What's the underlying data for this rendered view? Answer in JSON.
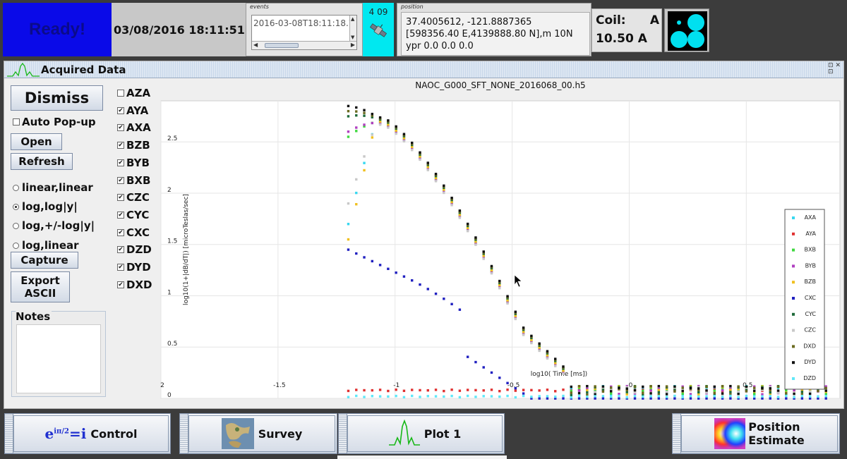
{
  "topbar": {
    "status": "Ready!",
    "datetime": "03/08/2016 18:11:51",
    "events": {
      "caption": "events",
      "value": "2016-03-08T18:11:18.7"
    },
    "satellites": "4 09",
    "position": {
      "caption": "position",
      "line1": "37.4005612, -121.8887365",
      "line2": "[598356.40 E,4139888.80 N],m 10N",
      "line3": "ypr 0.0 0.0 0.0"
    },
    "coil": {
      "label": "Coil:",
      "id": "A",
      "current": "10.50 A"
    }
  },
  "panel": {
    "title": "Acquired Data",
    "buttons": {
      "dismiss": "Dismiss",
      "open": "Open",
      "refresh": "Refresh",
      "capture": "Capture",
      "export_line1": "Export",
      "export_line2": "ASCII"
    },
    "auto_popup": "Auto Pop-up",
    "scales": [
      {
        "label": "linear,linear",
        "selected": false
      },
      {
        "label": "log,log|y|",
        "selected": true
      },
      {
        "label": "log,+/-log|y|",
        "selected": false
      },
      {
        "label": "log,linear",
        "selected": false
      }
    ],
    "notes_label": "Notes",
    "channels": [
      {
        "label": "AZA",
        "checked": false
      },
      {
        "label": "AYA",
        "checked": true
      },
      {
        "label": "AXA",
        "checked": true
      },
      {
        "label": "BZB",
        "checked": true
      },
      {
        "label": "BYB",
        "checked": true
      },
      {
        "label": "BXB",
        "checked": true
      },
      {
        "label": "CZC",
        "checked": true
      },
      {
        "label": "CYC",
        "checked": true
      },
      {
        "label": "CXC",
        "checked": true
      },
      {
        "label": "DZD",
        "checked": true
      },
      {
        "label": "DYD",
        "checked": true
      },
      {
        "label": "DXD",
        "checked": true
      }
    ]
  },
  "chart_data": {
    "type": "scatter",
    "title": "NAOC_G000_SFT_NONE_2016068_00.h5",
    "xlabel": "log10( Time [ms])",
    "ylabel": "log10(1+|dB/dT|) [microTeslas/sec]",
    "xlim": [
      -2,
      0.9
    ],
    "ylim": [
      0,
      2.9
    ],
    "xticks": [
      -2,
      -1.5,
      -1,
      -0.5,
      0,
      0.5
    ],
    "xtick_labels": [
      "2",
      "-1.5",
      "-1",
      "-0.5",
      "0",
      "0.5"
    ],
    "yticks": [
      0,
      0.5,
      1,
      1.5,
      2,
      2.5
    ],
    "ytick_labels": [
      "0",
      "0.5",
      "1",
      "1.5",
      "2",
      "2.5"
    ],
    "grid": true,
    "legend_position": "right",
    "series": [
      {
        "name": "AXA",
        "color": "#38d8f0",
        "kind": "main",
        "start": 1.7,
        "offset": 0.02
      },
      {
        "name": "AYA",
        "color": "#e03030",
        "kind": "flat",
        "level": 0.07
      },
      {
        "name": "BXB",
        "color": "#40d840",
        "kind": "main",
        "start": 2.55,
        "offset": 0.0
      },
      {
        "name": "BYB",
        "color": "#b040c0",
        "kind": "main",
        "start": 2.6,
        "offset": -0.01
      },
      {
        "name": "BZB",
        "color": "#f0c020",
        "kind": "main",
        "start": 1.55,
        "offset": 0.01
      },
      {
        "name": "CXC",
        "color": "#2020c0",
        "kind": "cxc",
        "start": 1.45
      },
      {
        "name": "CYC",
        "color": "#1f6a3a",
        "kind": "main",
        "start": 2.75,
        "offset": 0.03
      },
      {
        "name": "CZC",
        "color": "#c8c8c8",
        "kind": "main",
        "start": 1.9,
        "offset": -0.02
      },
      {
        "name": "DXD",
        "color": "#6a6a20",
        "kind": "main",
        "start": 2.8,
        "offset": 0.04
      },
      {
        "name": "DYD",
        "color": "#111111",
        "kind": "main",
        "start": 2.85,
        "offset": 0.05
      },
      {
        "name": "DZD",
        "color": "#60e8f8",
        "kind": "flat",
        "level": 0.01
      }
    ]
  },
  "tabs": [
    {
      "label": "Control",
      "icon": "euler-formula-icon",
      "formula": "e",
      "formula_sup": "iπ/2",
      "formula_rest": "=i"
    },
    {
      "label": "Survey",
      "icon": "survey-map-icon"
    },
    {
      "label": "Plot 1",
      "icon": "plot-wave-icon"
    },
    {
      "label_line1": "Position",
      "label_line2": "Estimate",
      "icon": "position-colormap-icon"
    }
  ]
}
